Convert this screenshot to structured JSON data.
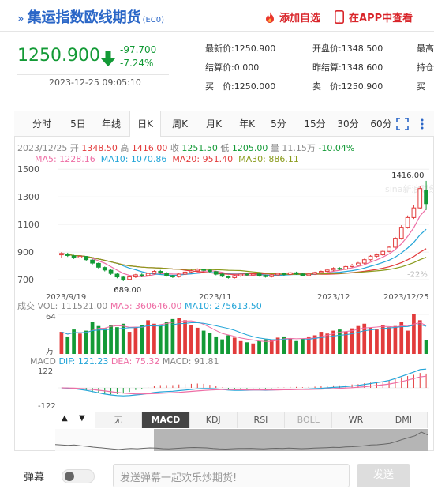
{
  "header": {
    "title_arrow": "»",
    "title": "集运指数欧线期货",
    "code": "(EC0)",
    "add_fav_label": "添加自选",
    "app_view_label": "在APP中查看",
    "icons": {
      "add_fav": "flame-icon",
      "app_view": "phone-icon"
    }
  },
  "quote": {
    "price": "1250.900",
    "change": "-97.700",
    "change_pct": "-7.24%",
    "datetime": "2023-12-25 09:05:10",
    "down_color": "#139a36",
    "stats_col1": [
      {
        "label": "最新价:",
        "value": "1250.900"
      },
      {
        "label": "结算价:",
        "value": "0.000"
      },
      {
        "label": "买　价:",
        "value": "1250.000"
      }
    ],
    "stats_col2": [
      {
        "label": "开盘价:",
        "value": "1348.500"
      },
      {
        "label": "昨结算:",
        "value": "1348.600"
      },
      {
        "label": "卖　价:",
        "value": "1250.900"
      }
    ],
    "stats_col3": [
      {
        "label": "最高"
      },
      {
        "label": "持仓"
      },
      {
        "label": "买"
      }
    ]
  },
  "period_tabs": [
    "分时",
    "5日",
    "年线",
    "日K",
    "周K",
    "月K",
    "年K",
    "5分",
    "15分",
    "30分",
    "60分"
  ],
  "active_period": "日K",
  "info_line": {
    "date": "2023/12/25",
    "open_label": "开",
    "open": "1348.50",
    "high_label": "高",
    "high": "1416.00",
    "close_label": "收",
    "close": "1251.50",
    "low_label": "低",
    "low": "1205.00",
    "vol_label": "量",
    "vol": "11.15万",
    "pct": "-10.04%"
  },
  "ma_line": {
    "ma5": "MA5: 1228.16",
    "ma10": "MA10: 1070.86",
    "ma20": "MA20: 951.40",
    "ma30": "MA30: 886.11"
  },
  "colors": {
    "up": "#e23b3b",
    "down": "#139a36",
    "ma5": "#ee6ea5",
    "ma10": "#24a5d8",
    "ma20": "#e23b3b",
    "ma30": "#8a9b1c"
  },
  "chart_data": {
    "type": "candlestick",
    "price_axis_ticks": [
      "1500",
      "1300",
      "1100",
      "900",
      "700"
    ],
    "price_range": [
      580,
      1530
    ],
    "date_labels": [
      "2023/9/19",
      "2023/11",
      "2023/12",
      "2023/12/25"
    ],
    "annotations": {
      "high_label": "1416.00",
      "low_label": "689.00",
      "pct_label": "-22%"
    },
    "watermark": "sina新浪财经",
    "candles": [
      [
        880,
        890,
        900,
        860
      ],
      [
        885,
        875,
        895,
        865
      ],
      [
        872,
        860,
        880,
        850
      ],
      [
        858,
        870,
        878,
        850
      ],
      [
        868,
        845,
        872,
        838
      ],
      [
        842,
        820,
        850,
        810
      ],
      [
        818,
        790,
        825,
        780
      ],
      [
        788,
        770,
        795,
        760
      ],
      [
        768,
        745,
        775,
        735
      ],
      [
        740,
        720,
        748,
        710
      ],
      [
        718,
        700,
        725,
        689
      ],
      [
        702,
        720,
        728,
        695
      ],
      [
        720,
        735,
        742,
        712
      ],
      [
        735,
        728,
        745,
        718
      ],
      [
        730,
        745,
        752,
        722
      ],
      [
        745,
        760,
        768,
        738
      ],
      [
        760,
        750,
        770,
        742
      ],
      [
        748,
        730,
        755,
        722
      ],
      [
        728,
        720,
        735,
        712
      ],
      [
        722,
        740,
        748,
        715
      ],
      [
        740,
        755,
        762,
        732
      ],
      [
        756,
        765,
        772,
        748
      ],
      [
        764,
        775,
        782,
        756
      ],
      [
        774,
        768,
        780,
        760
      ],
      [
        768,
        760,
        775,
        752
      ],
      [
        758,
        740,
        764,
        732
      ],
      [
        740,
        725,
        746,
        718
      ],
      [
        725,
        715,
        730,
        708
      ],
      [
        715,
        728,
        735,
        708
      ],
      [
        728,
        740,
        746,
        720
      ],
      [
        740,
        735,
        748,
        728
      ],
      [
        734,
        742,
        750,
        726
      ],
      [
        742,
        730,
        748,
        722
      ],
      [
        730,
        722,
        736,
        715
      ],
      [
        722,
        735,
        742,
        716
      ],
      [
        735,
        745,
        752,
        728
      ],
      [
        745,
        738,
        752,
        730
      ],
      [
        738,
        750,
        756,
        732
      ],
      [
        750,
        742,
        758,
        735
      ],
      [
        742,
        730,
        748,
        724
      ],
      [
        730,
        740,
        746,
        724
      ],
      [
        740,
        752,
        758,
        734
      ],
      [
        752,
        760,
        766,
        745
      ],
      [
        760,
        770,
        778,
        752
      ],
      [
        770,
        782,
        790,
        762
      ],
      [
        782,
        776,
        790,
        770
      ],
      [
        776,
        795,
        802,
        770
      ],
      [
        795,
        805,
        815,
        788
      ],
      [
        805,
        820,
        828,
        798
      ],
      [
        820,
        845,
        852,
        812
      ],
      [
        845,
        870,
        878,
        838
      ],
      [
        870,
        880,
        890,
        862
      ],
      [
        880,
        905,
        912,
        872
      ],
      [
        905,
        935,
        945,
        898
      ],
      [
        935,
        1000,
        1010,
        925
      ],
      [
        1000,
        1080,
        1095,
        990
      ],
      [
        1080,
        1150,
        1165,
        1070
      ],
      [
        1150,
        1220,
        1240,
        1140
      ],
      [
        1220,
        1360,
        1380,
        1210
      ],
      [
        1348,
        1251,
        1416,
        1205
      ]
    ],
    "volume_axis": {
      "top_label": "64",
      "bottom_label": "万"
    },
    "volume_legend": {
      "label": "成交",
      "vol": "VOL: 111521.00",
      "ma5": "MA5: 360646.00",
      "ma10": "MA10: 275613.50"
    },
    "volumes": [
      38,
      30,
      42,
      35,
      40,
      55,
      48,
      44,
      50,
      46,
      52,
      38,
      45,
      49,
      58,
      52,
      48,
      55,
      60,
      62,
      58,
      50,
      45,
      40,
      36,
      30,
      25,
      32,
      28,
      22,
      20,
      18,
      22,
      25,
      24,
      28,
      30,
      26,
      22,
      26,
      30,
      32,
      38,
      35,
      40,
      42,
      38,
      44,
      48,
      52,
      45,
      42,
      50,
      46,
      48,
      55,
      40,
      68,
      58,
      24
    ],
    "macd_legend": {
      "label": "MACD",
      "dif": "DIF: 121.23",
      "dea": "DEA: 75.32",
      "macd": "MACD: 91.81"
    },
    "macd_axis": {
      "top": "122",
      "bottom": "-122"
    },
    "macd_dif": [
      0,
      -2,
      -5,
      -10,
      -16,
      -24,
      -32,
      -40,
      -46,
      -50,
      -52,
      -50,
      -46,
      -42,
      -36,
      -30,
      -26,
      -24,
      -22,
      -18,
      -14,
      -10,
      -6,
      -4,
      -4,
      -6,
      -10,
      -14,
      -16,
      -16,
      -15,
      -14,
      -14,
      -15,
      -14,
      -12,
      -11,
      -9,
      -8,
      -8,
      -7,
      -5,
      -3,
      0,
      3,
      5,
      8,
      12,
      16,
      22,
      28,
      34,
      40,
      48,
      60,
      74,
      88,
      102,
      118,
      121
    ],
    "macd_dea": [
      0,
      -1,
      -2,
      -4,
      -7,
      -10,
      -15,
      -20,
      -25,
      -30,
      -34,
      -37,
      -39,
      -39,
      -38,
      -37,
      -35,
      -33,
      -31,
      -29,
      -26,
      -23,
      -20,
      -17,
      -14,
      -12,
      -11,
      -11,
      -12,
      -12,
      -13,
      -13,
      -13,
      -13,
      -13,
      -13,
      -12,
      -12,
      -11,
      -10,
      -10,
      -9,
      -8,
      -6,
      -5,
      -3,
      -1,
      1,
      4,
      7,
      11,
      15,
      20,
      25,
      32,
      40,
      50,
      60,
      70,
      75
    ]
  },
  "indicator_tabs": [
    "无",
    "MACD",
    "KDJ",
    "RSI",
    "BOLL",
    "WR",
    "DMI"
  ],
  "active_indicator": "MACD",
  "disabled_indicator": "BOLL",
  "nav_arrows": {
    "left": "▲",
    "right": "▼"
  },
  "danmu": {
    "label": "弹幕",
    "placeholder": "发送弹幕一起欢乐炒期货!",
    "send_label": "发送"
  }
}
